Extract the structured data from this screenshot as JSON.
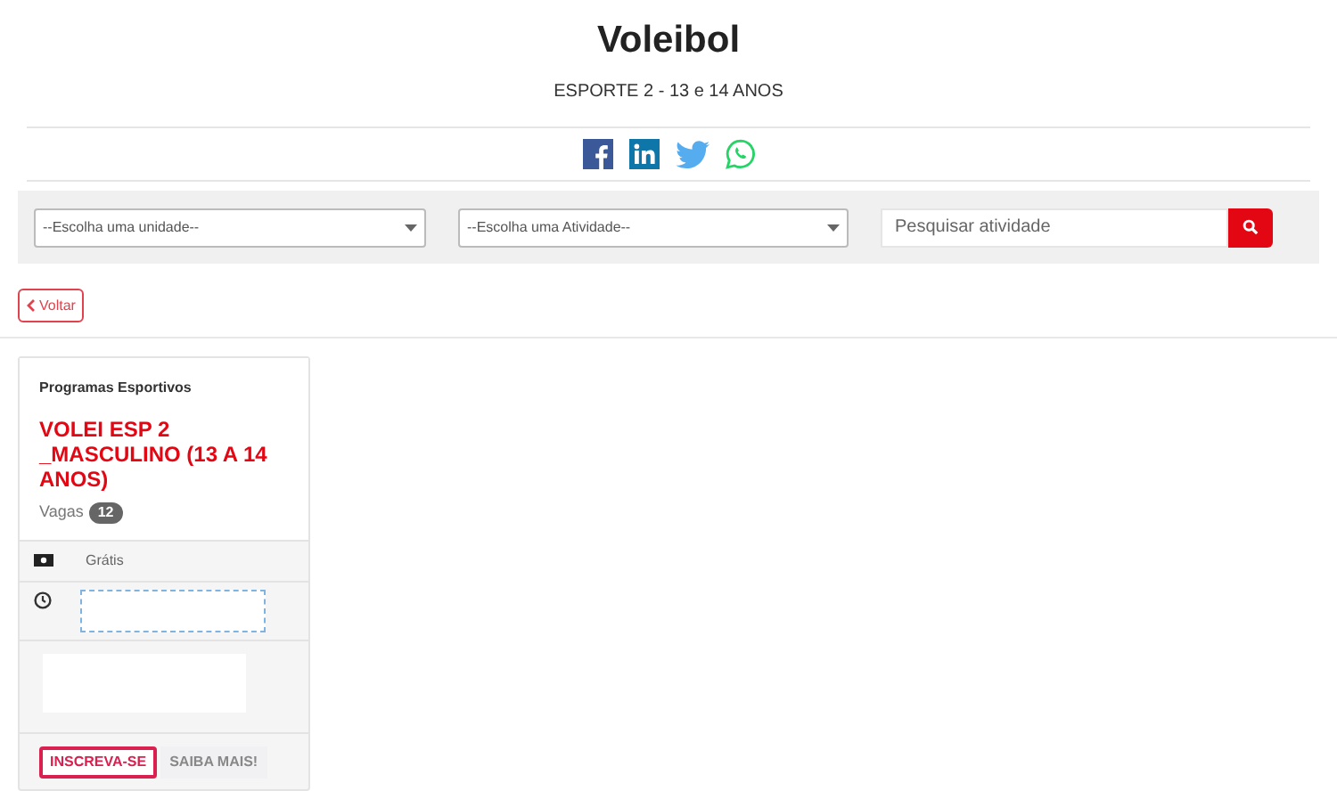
{
  "header": {
    "title": "Voleibol",
    "subtitle": "ESPORTE 2 - 13 e 14 ANOS"
  },
  "filters": {
    "unit_select": "--Escolha uma unidade--",
    "activity_select": "--Escolha uma Atividade--",
    "search": {
      "placeholder": "Pesquisar atividade"
    }
  },
  "back_button": "Voltar",
  "card": {
    "category": "Programas Esportivos",
    "title": "VOLEI ESP 2 _MASCULINO (13 A 14 ANOS)",
    "vacancies_label": "Vagas",
    "vacancies": "12",
    "price": "Grátis",
    "buttons": [
      "INSCREVA-SE",
      "SAIBA MAIS!"
    ]
  }
}
